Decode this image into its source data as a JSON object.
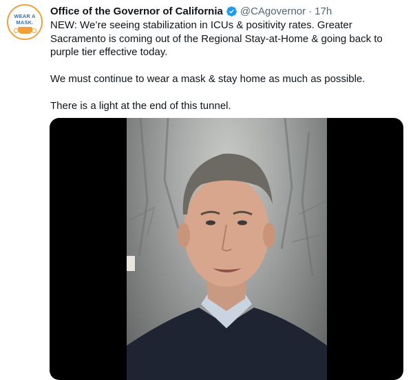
{
  "tweet": {
    "author": {
      "name": "Office of the Governor of California",
      "handle": "@CAgovernor",
      "time": "17h",
      "separator": "·",
      "avatar_text_line1": "WEAR A",
      "avatar_text_line2": "MASK."
    },
    "more_icon_label": "ooo",
    "paragraphs": [
      "NEW: We’re seeing stabilization in ICUs & positivity rates. Greater Sacramento is coming out of the Regional Stay-at-Home & going back to purple tier effective today.",
      "We must continue to wear a mask & stay home as much as possible.",
      "There is a light at the end of this tunnel."
    ],
    "media": {
      "type": "video"
    }
  },
  "colors": {
    "text": "#0f1419",
    "secondary": "#536471",
    "verified": "#1d9bf0",
    "avatar_accent": "#f0a03a",
    "avatar_text": "#3a6fb5",
    "media_bg": "#000000"
  }
}
